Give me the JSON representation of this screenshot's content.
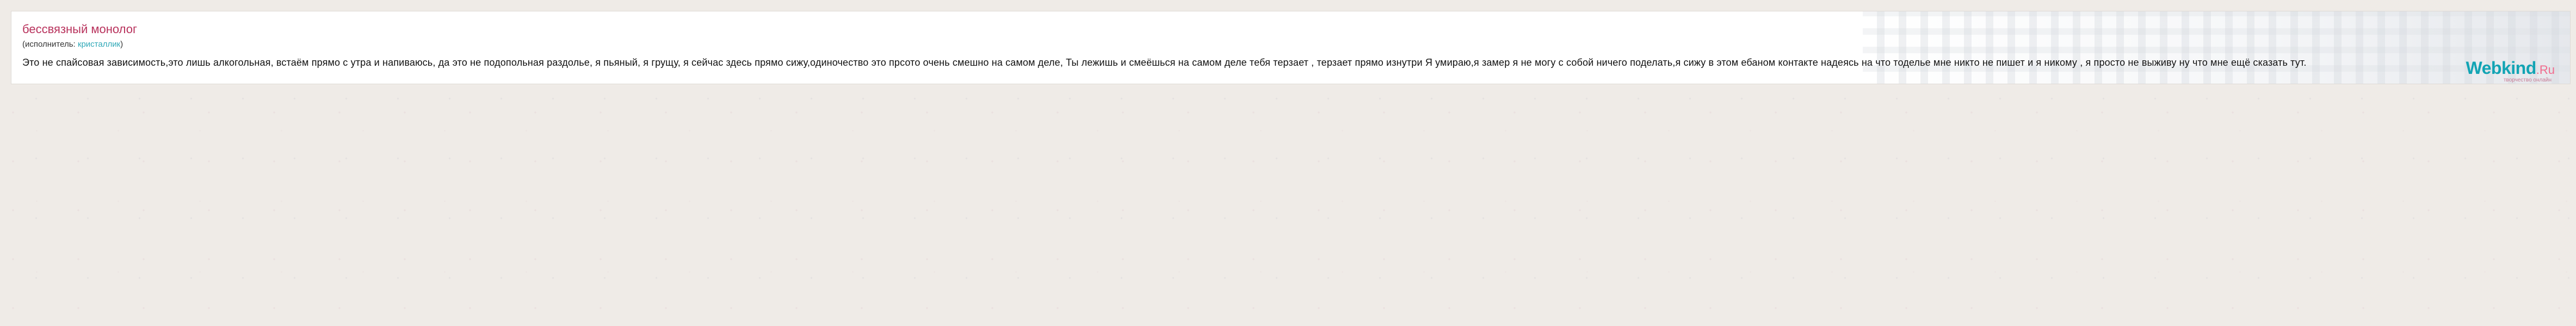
{
  "post": {
    "title": "бессвязный монолог",
    "performer_prefix": "(исполнитель: ",
    "performer_name": "кристаллик",
    "performer_suffix": ")",
    "body": "Это не спайсовая зависимость,это лишь алкогольная,  встаём прямо с утра и напиваюсь, да это не подопольная раздолье, я пьяный, я грущу, я сейчас здесь прямо сижу,одиночество это прсото  очень смешно на самом деле, Ты лежишь и смеёшься на самом деле тебя терзает , терзает прямо изнутри Я умираю,я замер  я не могу с собой ничего поделать,я сижу в этом ебаном контакте надеясь на что тоделье мне никто не пишет и я никому , я просто не выживу ну  что мне ещё сказать тут."
  },
  "brand": {
    "name": "Webkind",
    "suffix": ".Ru",
    "tagline": "творчество онлайн"
  },
  "colors": {
    "title": "#b8325c",
    "link": "#2fa8b7",
    "brand_main": "#12a4b4",
    "brand_suffix": "#f16b8d",
    "page_background": "#efebe7"
  }
}
